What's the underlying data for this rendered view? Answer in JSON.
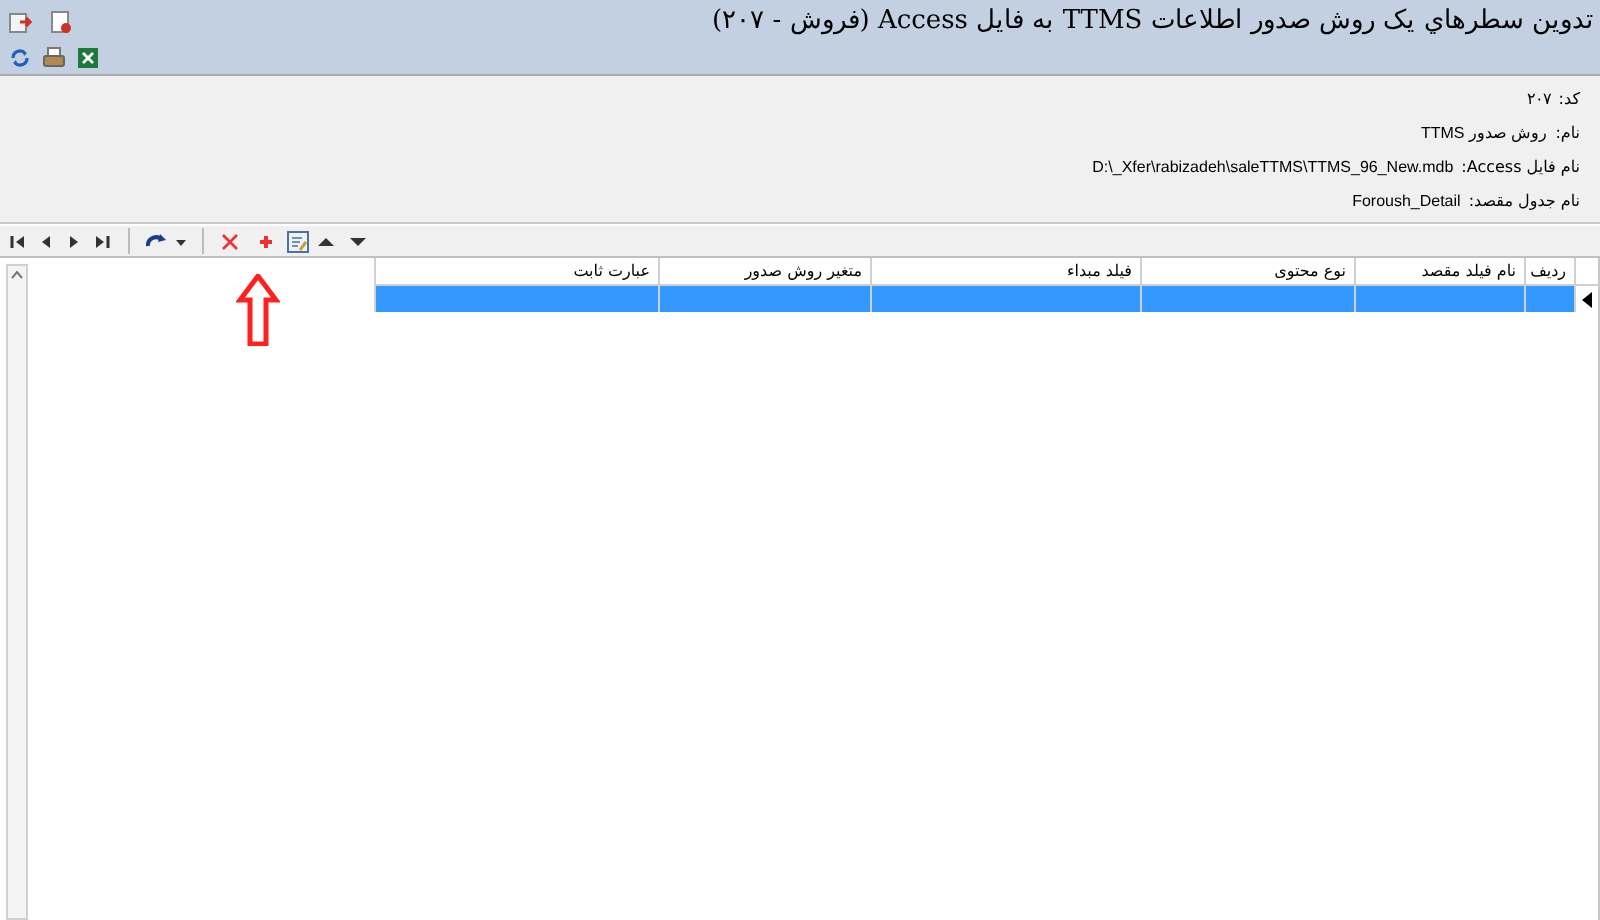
{
  "window": {
    "title": "تدوین سطرهاي یک روش صدور اطلاعات TTMS به فایل Access (فروش - ۲۰۷)"
  },
  "info": [
    {
      "label": "کد:",
      "value": "۲۰۷"
    },
    {
      "label": "نام:",
      "value": "روش صدور TTMS"
    },
    {
      "label": "نام فایل Access:",
      "value": "D:\\_Xfer\\rabizadeh\\saleTTMS\\TTMS_96_New.mdb"
    },
    {
      "label": "نام جدول مقصد:",
      "value": "Foroush_Detail"
    }
  ],
  "grid": {
    "columns": [
      "ردیف",
      "نام فیلد مقصد",
      "نوع محتوی",
      "فیلد مبداء",
      "متغیر روش صدور",
      "عبارت ثابت"
    ],
    "rows": [
      {
        "selected": true
      }
    ]
  }
}
